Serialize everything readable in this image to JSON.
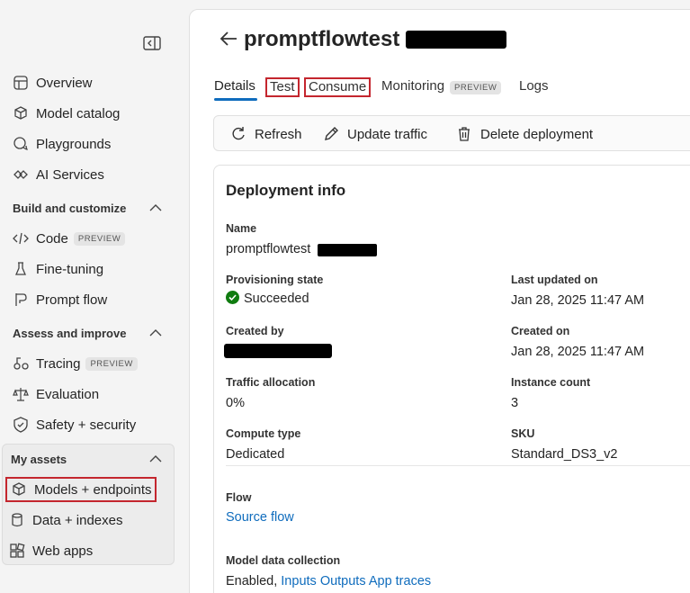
{
  "sidebar": {
    "items_top": [
      {
        "label": "Overview",
        "icon": "dashboard-icon"
      },
      {
        "label": "Model catalog",
        "icon": "cube-stack-icon"
      },
      {
        "label": "Playgrounds",
        "icon": "chat-bubbles-icon"
      },
      {
        "label": "AI Services",
        "icon": "ai-services-icon"
      }
    ],
    "section_build": "Build and customize",
    "items_build": [
      {
        "label": "Code",
        "badge": "PREVIEW",
        "icon": "code-icon"
      },
      {
        "label": "Fine-tuning",
        "icon": "flask-icon"
      },
      {
        "label": "Prompt flow",
        "icon": "flow-icon"
      }
    ],
    "section_assess": "Assess and improve",
    "items_assess": [
      {
        "label": "Tracing",
        "badge": "PREVIEW",
        "icon": "tracing-icon"
      },
      {
        "label": "Evaluation",
        "icon": "scales-icon"
      },
      {
        "label": "Safety + security",
        "icon": "shield-icon"
      }
    ],
    "section_assets": "My assets",
    "items_assets": [
      {
        "label": "Models + endpoints",
        "icon": "cube-icon"
      },
      {
        "label": "Data + indexes",
        "icon": "database-icon"
      },
      {
        "label": "Web apps",
        "icon": "apps-icon"
      }
    ]
  },
  "header": {
    "title": "promptflowtest"
  },
  "tabs": [
    {
      "label": "Details"
    },
    {
      "label": "Test"
    },
    {
      "label": "Consume"
    },
    {
      "label": "Monitoring",
      "badge": "PREVIEW"
    },
    {
      "label": "Logs"
    }
  ],
  "toolbar": {
    "refresh": "Refresh",
    "update_traffic": "Update traffic",
    "delete_deployment": "Delete deployment"
  },
  "deployment_info": {
    "title": "Deployment info",
    "name_label": "Name",
    "name_value": "promptflowtest",
    "provisioning_label": "Provisioning state",
    "provisioning_value": "Succeeded",
    "last_updated_label": "Last updated on",
    "last_updated_value": "Jan 28, 2025 11:47 AM",
    "created_by_label": "Created by",
    "created_on_label": "Created on",
    "created_on_value": "Jan 28, 2025 11:47 AM",
    "traffic_label": "Traffic allocation",
    "traffic_value": "0%",
    "instance_label": "Instance count",
    "instance_value": "3",
    "compute_label": "Compute type",
    "compute_value": "Dedicated",
    "sku_label": "SKU",
    "sku_value": "Standard_DS3_v2",
    "flow_label": "Flow",
    "flow_value": "Source flow",
    "collection_label": "Model data collection",
    "collection_value": "Enabled,",
    "collection_links": [
      "Inputs",
      "Outputs",
      "App traces"
    ]
  },
  "colors": {
    "accent": "#0f6cbd",
    "success": "#107c10",
    "highlight_border": "#c4262e"
  }
}
